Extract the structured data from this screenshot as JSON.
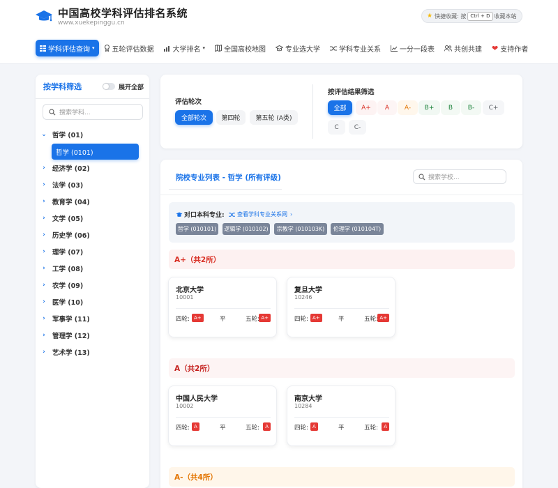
{
  "header": {
    "title": "中国高校学科评估排名系统",
    "url": "www.xuekepinggu.cn",
    "bookmark": {
      "prefix": "快捷收藏: 按",
      "key": "Ctrl + D",
      "suffix": "收藏本站",
      "close": "×"
    }
  },
  "nav": [
    {
      "label": "学科评估查询",
      "icon": "grid-icon",
      "active": true,
      "caret": "▾"
    },
    {
      "label": "五轮评估数据",
      "icon": "award-icon"
    },
    {
      "label": "大学排名",
      "icon": "bar-chart-icon",
      "caret": "▾"
    },
    {
      "label": "全国高校地图",
      "icon": "map-icon"
    },
    {
      "label": "专业选大学",
      "icon": "graduation-cap-icon"
    },
    {
      "label": "学科专业关系",
      "icon": "shuffle-icon"
    },
    {
      "label": "一分一段表",
      "icon": "line-chart-icon"
    },
    {
      "label": "共创共建",
      "icon": "users-icon"
    },
    {
      "label": "支持作者",
      "icon": "heart-icon"
    }
  ],
  "sidebar": {
    "title": "按学科筛选",
    "toggle_label": "展开全部",
    "search_placeholder": "搜索学科...",
    "items": [
      {
        "label": "哲学 (01)",
        "expanded": true
      },
      {
        "label": "经济学 (02)"
      },
      {
        "label": "法学 (03)"
      },
      {
        "label": "教育学 (04)"
      },
      {
        "label": "文学 (05)"
      },
      {
        "label": "历史学 (06)"
      },
      {
        "label": "理学 (07)"
      },
      {
        "label": "工学 (08)"
      },
      {
        "label": "农学 (09)"
      },
      {
        "label": "医学 (10)"
      },
      {
        "label": "军事学 (11)"
      },
      {
        "label": "管理学 (12)"
      },
      {
        "label": "艺术学 (13)"
      }
    ],
    "child": "哲学 (0101)"
  },
  "filters": {
    "round_label": "评估轮次",
    "rounds": [
      "全部轮次",
      "第四轮",
      "第五轮 (A类)"
    ],
    "result_label": "按评估结果筛选",
    "results": [
      "全部",
      "A+",
      "A",
      "A-",
      "B+",
      "B",
      "B-",
      "C+",
      "C",
      "C-"
    ],
    "colors": {
      "A+": "#d93025",
      "A": "#d93025",
      "A-": "#e37400",
      "B+": "#188038",
      "B": "#188038",
      "B-": "#188038",
      "C+": "#5f6368",
      "C": "#5f6368",
      "C-": "#5f6368"
    }
  },
  "main": {
    "title": "院校专业列表 - 哲学 (所有评级)",
    "search_placeholder": "搜索学校...",
    "match_label": "对口本科专业:",
    "match_link": "查看学科专业关系网",
    "tags": [
      "哲学 (010101)",
      "逻辑学 (010102)",
      "宗教学 (010103K)",
      "伦理学 (010104T)"
    ],
    "groups": [
      {
        "title": "A+（共2所）",
        "cls": "ap",
        "unis": [
          {
            "name": "北京大学",
            "code": "10001",
            "r4_label": "四轮:",
            "r4": "A+",
            "mid": "平",
            "r5_label": "五轮:",
            "r5": "A+"
          },
          {
            "name": "复旦大学",
            "code": "10246",
            "r4_label": "四轮:",
            "r4": "A+",
            "mid": "平",
            "r5_label": "五轮:",
            "r5": "A+"
          }
        ]
      },
      {
        "title": "A（共2所）",
        "cls": "a",
        "unis": [
          {
            "name": "中国人民大学",
            "code": "10002",
            "r4_label": "四轮:",
            "r4": "A",
            "mid": "平",
            "r5_label": "五轮:",
            "r5": "A"
          },
          {
            "name": "南京大学",
            "code": "10284",
            "r4_label": "四轮:",
            "r4": "A",
            "mid": "平",
            "r5_label": "五轮:",
            "r5": "A"
          }
        ]
      },
      {
        "title": "A-（共4所）",
        "cls": "am",
        "unis": []
      }
    ]
  }
}
